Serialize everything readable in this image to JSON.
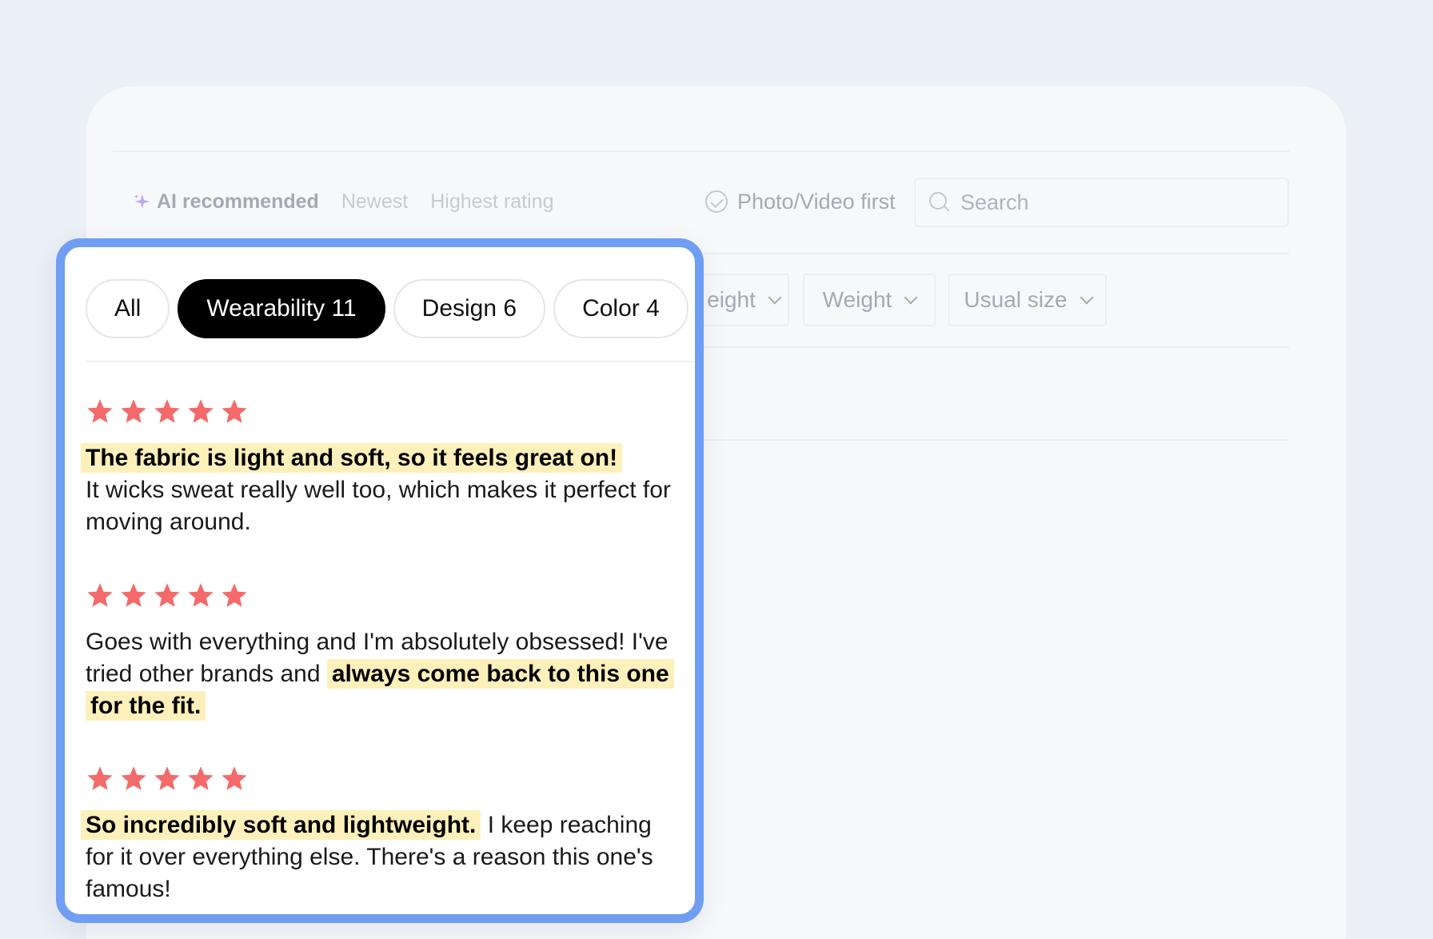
{
  "sort": {
    "ai_label": "AI recommended",
    "newest_label": "Newest",
    "highest_label": "Highest rating",
    "photo_video_label": "Photo/Video first"
  },
  "search": {
    "placeholder": "Search"
  },
  "dropdowns": {
    "height_label": "eight",
    "weight_label": "Weight",
    "usual_size_label": "Usual size"
  },
  "chips": [
    {
      "label": "All",
      "active": false
    },
    {
      "label": "Wearability 11",
      "active": true
    },
    {
      "label": "Design 6",
      "active": false
    },
    {
      "label": "Color 4",
      "active": false
    }
  ],
  "reviews": [
    {
      "rating": 5,
      "highlight": "The fabric is light and soft, so it feels great on!",
      "text_before": "",
      "text_after": "It wicks sweat really well too, which makes it perfect for moving around."
    },
    {
      "rating": 5,
      "text_before": "Goes with everything and I'm absolutely obsessed! I've tried other brands and",
      "highlight": "always come back to this one for the fit.",
      "text_after": ""
    },
    {
      "rating": 5,
      "text_before": "",
      "highlight": "So incredibly soft and lightweight.",
      "text_after": "I keep reaching for it over everything else. There's a reason this one's famous!"
    }
  ],
  "colors": {
    "accent_border": "#6f9ef2",
    "star": "#f46a6a",
    "highlight": "#fdf0bb",
    "active_chip": "#000000"
  }
}
